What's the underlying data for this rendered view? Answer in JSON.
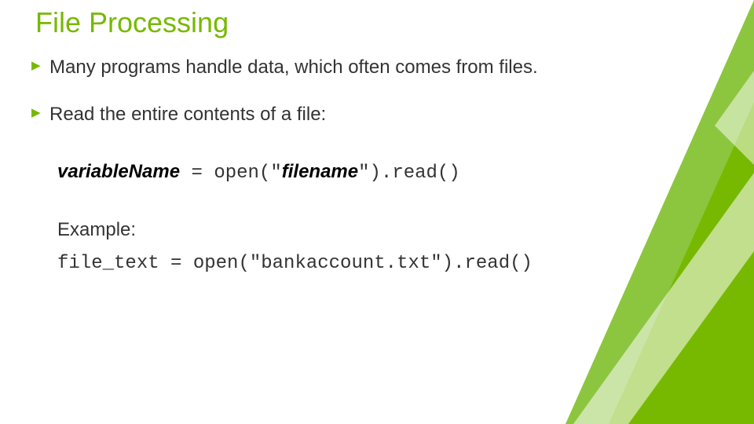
{
  "title": "File Processing",
  "bullets": [
    "Many programs handle data, which often comes from files.",
    "Read the entire contents of a file:"
  ],
  "syntax": {
    "var": "variableName",
    "eq": " = ",
    "open": "open(\"",
    "fname": "filename",
    "close": "\").read()"
  },
  "example_label": "Example:",
  "example_code": "file_text = open(\"bankaccount.txt\").read()",
  "colors": {
    "accent": "#76b900"
  }
}
